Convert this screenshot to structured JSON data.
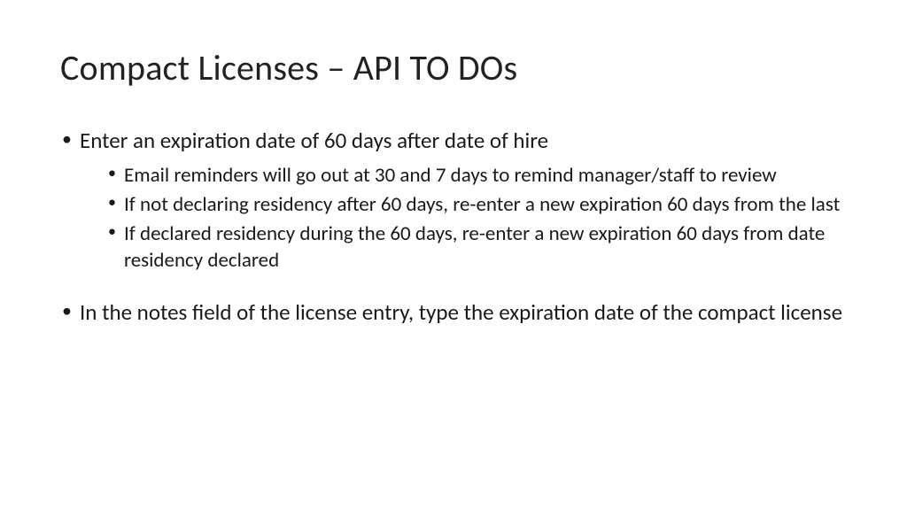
{
  "title": "Compact Licenses – API TO DOs",
  "bullets": [
    {
      "text": "Enter an expiration date of 60 days after date of hire",
      "sub": [
        "Email reminders will go out at 30 and 7 days to remind manager/staff to review",
        "If not declaring residency after 60 days, re-enter a new expiration 60 days from the last",
        "If declared residency during the 60 days, re-enter a new expiration 60 days from date residency declared"
      ]
    },
    {
      "text": "In the notes field of the license entry, type the expiration date of the compact license",
      "sub": []
    }
  ]
}
